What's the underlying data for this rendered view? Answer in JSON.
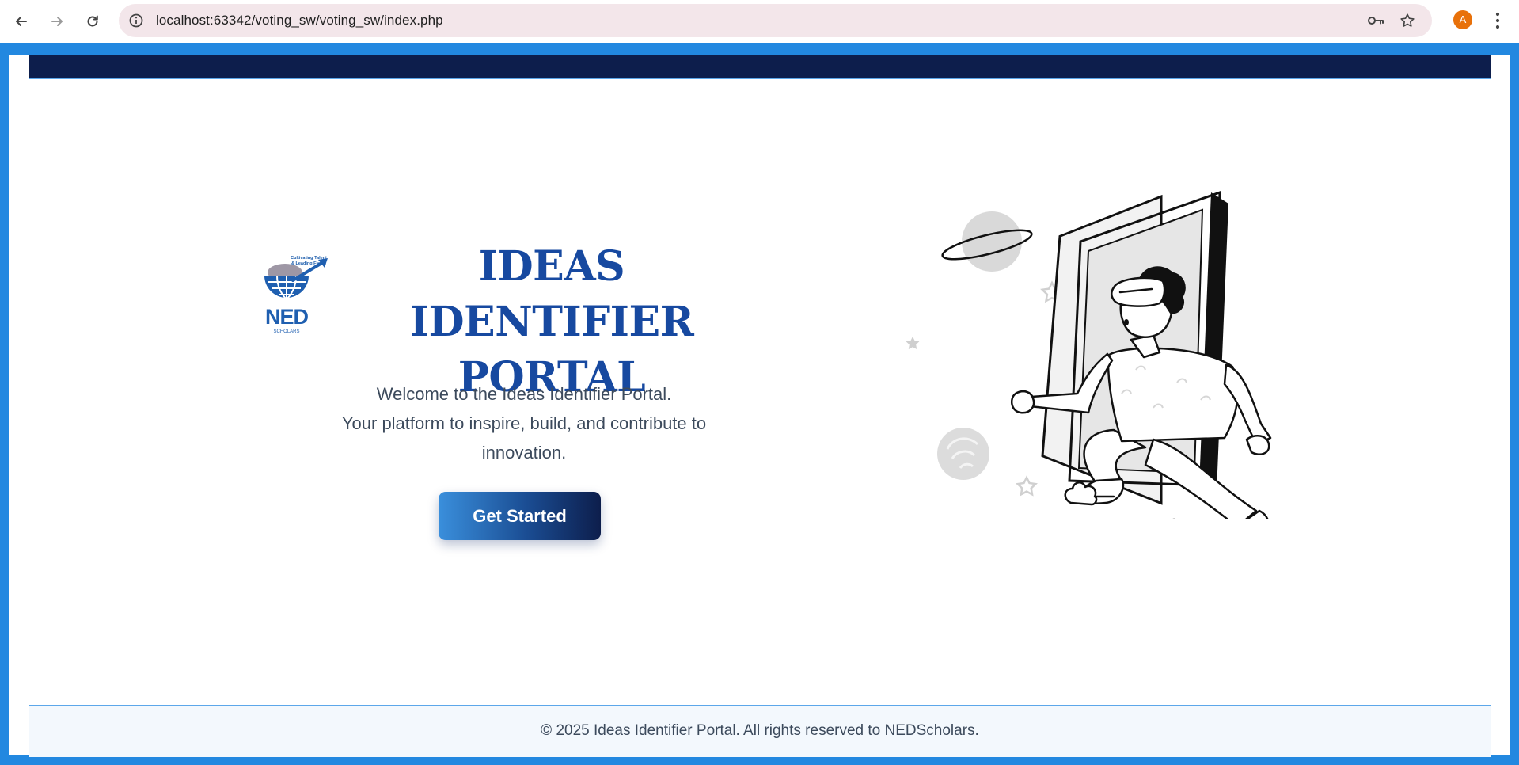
{
  "browser": {
    "url": "localhost:63342/voting_sw/voting_sw/index.php",
    "profile_initial": "A",
    "profile_color": "#e8710a"
  },
  "icons": {
    "back": "arrow-left-icon",
    "forward": "arrow-right-icon",
    "reload": "reload-icon",
    "site_info": "info-circle-icon",
    "password": "key-icon",
    "bookmark": "star-icon",
    "menu": "kebab-menu-icon"
  },
  "colors": {
    "frame": "#2288e0",
    "nav": "#0d1e4c",
    "title": "#1749a0",
    "accent_line": "#5ca7ea"
  },
  "hero": {
    "title_line1": "IDEAS IDENTIFIER",
    "title_line2": "PORTAL",
    "welcome_line1": "Welcome to the Ideas Identifier Portal.",
    "welcome_line2": "Your platform to inspire, build, and contribute to",
    "welcome_line3": "innovation.",
    "cta_label": "Get Started",
    "logo_alt": "NED Scholars logo",
    "logo_text": "NED",
    "logo_sub": "SCHOLARS",
    "logo_tagline1": "Cultivating Talent",
    "logo_tagline2": "& Leading Fields"
  },
  "footer": {
    "text": "© 2025 Ideas Identifier Portal. All rights reserved to NEDScholars."
  }
}
